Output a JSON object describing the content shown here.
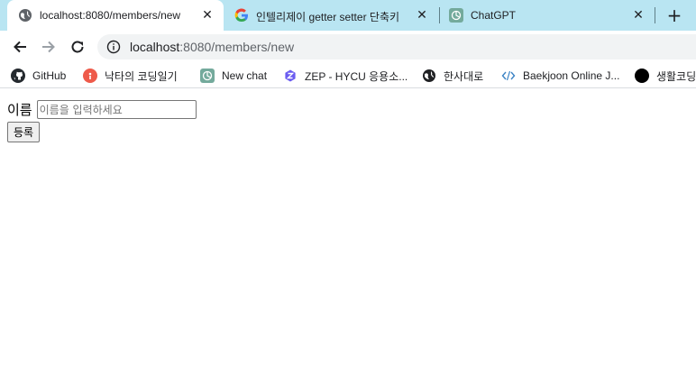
{
  "browser": {
    "tabs": [
      {
        "title": "localhost:8080/members/new",
        "icon": "globe-icon",
        "active": true,
        "close": "✕"
      },
      {
        "title": "인텔리제이 getter setter 단축키",
        "icon": "google-icon",
        "active": false,
        "close": "✕"
      },
      {
        "title": "ChatGPT",
        "icon": "chatgpt-icon",
        "active": false,
        "close": "✕"
      }
    ],
    "new_tab": "+",
    "address": {
      "host": "localhost",
      "path": ":8080/members/new"
    },
    "bookmarks": [
      {
        "label": "GitHub",
        "icon": "github-icon"
      },
      {
        "label": "낙타의 코딩일기",
        "icon": "blog-icon"
      },
      {
        "label": "New chat",
        "icon": "chatgpt-icon"
      },
      {
        "label": "ZEP - HYCU 응용소...",
        "icon": "zep-icon"
      },
      {
        "label": "한사대로",
        "icon": "globe-icon"
      },
      {
        "label": "Baekjoon Online J...",
        "icon": "code-icon"
      },
      {
        "label": "생활코딩",
        "icon": "circle-icon"
      }
    ]
  },
  "form": {
    "name_label": "이름",
    "name_placeholder": "이름을 입력하세요",
    "name_value": "",
    "submit_label": "등록"
  },
  "colors": {
    "tabstrip": "#b9e5f2",
    "active_tab": "#ffffff",
    "omnibox": "#f1f3f4"
  }
}
